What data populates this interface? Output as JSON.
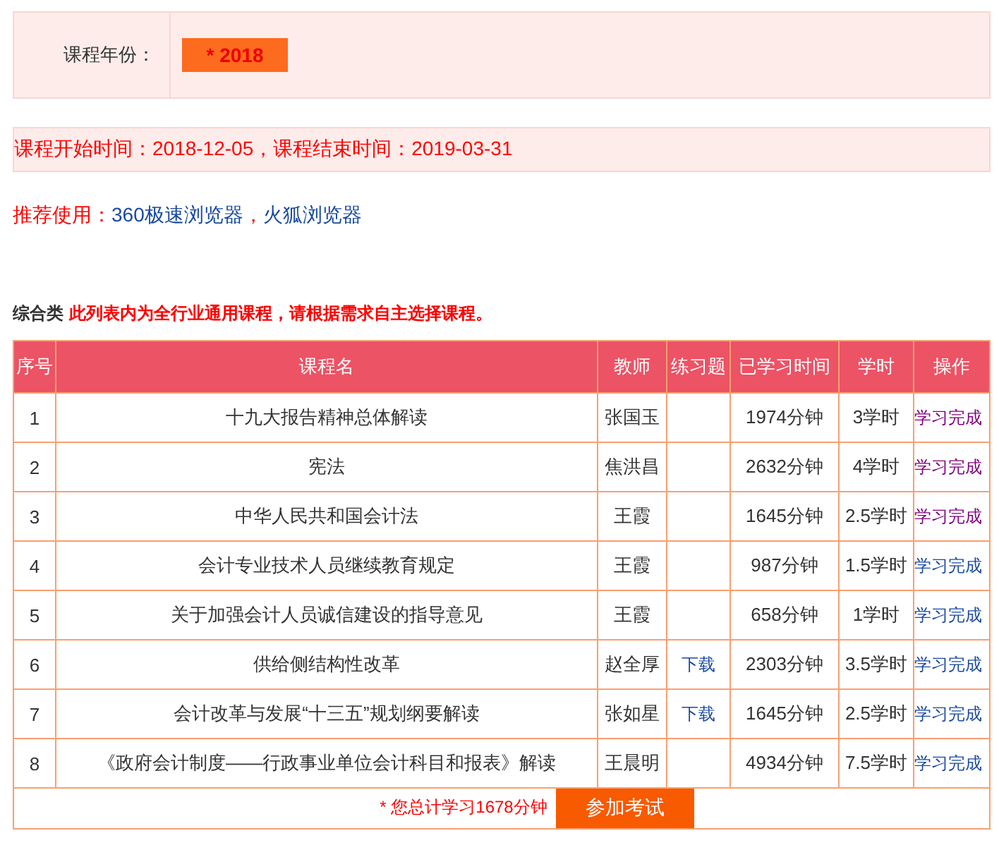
{
  "year_filter": {
    "label": "课程年份：",
    "value": "* 2018"
  },
  "period": {
    "start_label": "课程开始时间：",
    "start": "2018-12-05",
    "separator": "，",
    "end_label": "课程结束时间：",
    "end": "2019-03-31"
  },
  "recommend": {
    "label": "推荐使用：",
    "browsers": [
      "360极速浏览器",
      "火狐浏览器"
    ],
    "separator": "，"
  },
  "section": {
    "title": "综合类",
    "note": "此列表内为全行业通用课程，请根据需求自主选择课程。"
  },
  "table": {
    "columns": [
      "序号",
      "课程名",
      "教师",
      "练习题",
      "已学习时间",
      "学时",
      "操作"
    ],
    "rows": [
      {
        "no": "1",
        "course": "十九大报告精神总体解读",
        "teacher": "张国玉",
        "exercise": "",
        "studied": "1974分钟",
        "hours": "3学时",
        "action": "学习完成",
        "visited": true
      },
      {
        "no": "2",
        "course": "宪法",
        "teacher": "焦洪昌",
        "exercise": "",
        "studied": "2632分钟",
        "hours": "4学时",
        "action": "学习完成",
        "visited": true
      },
      {
        "no": "3",
        "course": "中华人民共和国会计法",
        "teacher": "王霞",
        "exercise": "",
        "studied": "1645分钟",
        "hours": "2.5学时",
        "action": "学习完成",
        "visited": true
      },
      {
        "no": "4",
        "course": "会计专业技术人员继续教育规定",
        "teacher": "王霞",
        "exercise": "",
        "studied": "987分钟",
        "hours": "1.5学时",
        "action": "学习完成",
        "visited": false
      },
      {
        "no": "5",
        "course": "关于加强会计人员诚信建设的指导意见",
        "teacher": "王霞",
        "exercise": "",
        "studied": "658分钟",
        "hours": "1学时",
        "action": "学习完成",
        "visited": false
      },
      {
        "no": "6",
        "course": "供给侧结构性改革",
        "teacher": "赵全厚",
        "exercise": "下载",
        "studied": "2303分钟",
        "hours": "3.5学时",
        "action": "学习完成",
        "visited": false
      },
      {
        "no": "7",
        "course": "会计改革与发展“十三五”规划纲要解读",
        "teacher": "张如星",
        "exercise": "下载",
        "studied": "1645分钟",
        "hours": "2.5学时",
        "action": "学习完成",
        "visited": false
      },
      {
        "no": "8",
        "course": "《政府会计制度——行政事业单位会计科目和报表》解读",
        "teacher": "王晨明",
        "exercise": "",
        "studied": "4934分钟",
        "hours": "7.5学时",
        "action": "学习完成",
        "visited": false
      }
    ],
    "footer": {
      "total": "* 您总计学习1678分钟",
      "button": "参加考试"
    }
  }
}
